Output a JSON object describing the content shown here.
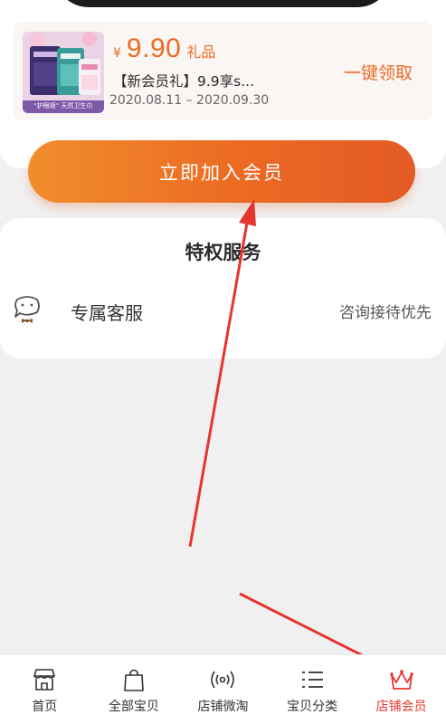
{
  "coupon": {
    "currency": "¥",
    "price": "9.90",
    "tag": "礼品",
    "description": "【新会员礼】9.9享s...",
    "date_range": "2020.08.11 – 2020.09.30",
    "claim_label": "一键领取",
    "thumbnail_icon": "product-image",
    "thumbnail_caption": "\"护眼姬\" 天然卫生巾"
  },
  "join_button": {
    "label": "立即加入会员",
    "color_start": "#f08d2c",
    "color_end": "#e35a25"
  },
  "privileges": {
    "title": "特权服务",
    "items": [
      {
        "icon": "chat-bubble-bowtie-icon",
        "name": "专属客服",
        "description": "咨询接待优先"
      }
    ]
  },
  "bottom_nav": {
    "items": [
      {
        "icon": "store-icon",
        "label": "首页",
        "active": false
      },
      {
        "icon": "shopping-bag-icon",
        "label": "全部宝贝",
        "active": false
      },
      {
        "icon": "broadcast-icon",
        "label": "店铺微淘",
        "active": false
      },
      {
        "icon": "list-icon",
        "label": "宝贝分类",
        "active": false
      },
      {
        "icon": "crown-icon",
        "label": "店铺会员",
        "active": true
      }
    ],
    "active_color": "#e8352d"
  },
  "annotation_color": "#e5352d"
}
